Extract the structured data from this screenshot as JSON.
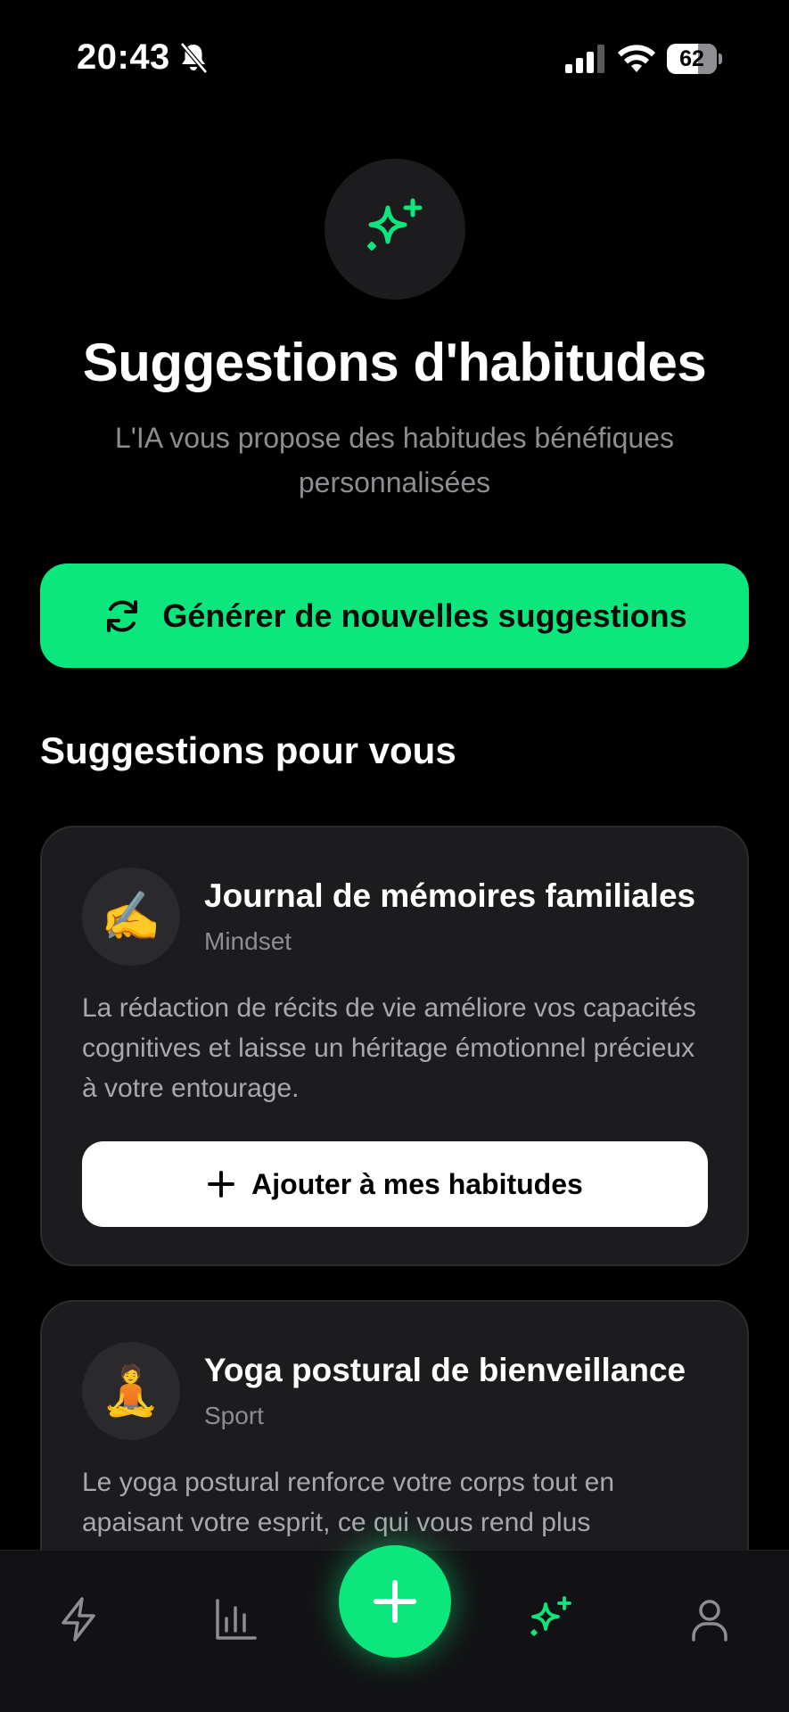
{
  "status_bar": {
    "time": "20:43",
    "battery_percent": "62",
    "battery_level": 0.62,
    "icons": [
      "bell-slash-icon",
      "cellular-signal-icon",
      "wifi-icon",
      "battery-icon"
    ]
  },
  "hero": {
    "icon": "sparkles-icon",
    "title": "Suggestions d'habitudes",
    "subtitle": "L'IA vous propose des habitudes bénéfiques personnalisées"
  },
  "generate_button": {
    "icon": "refresh-icon",
    "label": "Générer de nouvelles suggestions"
  },
  "section": {
    "title": "Suggestions pour vous"
  },
  "suggestions": [
    {
      "emoji": "✍️",
      "title": "Journal de mémoires familiales",
      "category": "Mindset",
      "description": "La rédaction de récits de vie améliore vos capacités cognitives et laisse un héritage émotionnel précieux à votre entourage.",
      "add_label": "Ajouter à mes habitudes"
    },
    {
      "emoji": "🧘",
      "title": "Yoga postural de bienveillance",
      "category": "Sport",
      "description": "Le yoga postural renforce votre corps tout en apaisant votre esprit, ce qui vous rend plus"
    }
  ],
  "tab_bar": {
    "tabs": [
      "lightning-icon",
      "stats-chart-icon",
      "add-icon",
      "sparkles-icon",
      "profile-icon"
    ],
    "active_tab": "sparkles-icon",
    "colors": {
      "accent": "#0be67d",
      "inactive": "#8d8d92"
    }
  },
  "colors": {
    "accent": "#0be67d",
    "background": "#000000",
    "card": "#1c1c1e",
    "muted_text": "#8d8d92"
  }
}
